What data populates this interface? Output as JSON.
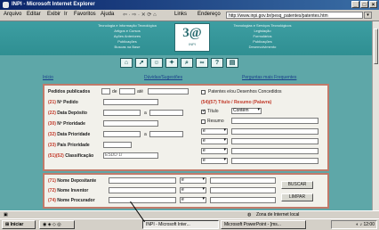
{
  "window": {
    "title": "INPI - Microsoft Internet Explorer"
  },
  "menu": [
    "Arquivo",
    "Editar",
    "Exibir",
    "Ir",
    "Favoritos",
    "Ajuda"
  ],
  "toolbar": {
    "links_label": "Links",
    "address_label": "Endereço",
    "address": "http://www.inpi.gov.br/pesq_patentes/patentes.htm"
  },
  "banner": {
    "logo_text": "3@",
    "logo_sub": "INPI",
    "left_lines": [
      "Tecnologia e Informação Tecnológica",
      "Artigos e Cursos",
      "Ações Anteriores",
      "Publicações",
      "Buscas na Base"
    ],
    "right_lines": [
      "Tecnologias e Serviços Tecnológicos",
      "Legislação",
      "Formulários",
      "Publicações",
      "Desenvolvimento"
    ]
  },
  "nav_icons": [
    "home-icon",
    "arrow-icon",
    "person-icon",
    "help-icon",
    "search-icon",
    "graph-icon",
    "question-icon",
    "book-icon"
  ],
  "links": {
    "home": "Início",
    "consult": "Dúvidas/Sugestões",
    "faq": "Perguntas mais Frequentes"
  },
  "form": {
    "published_label": "Pedidos publicados",
    "published_from": "de",
    "published_to": "até",
    "rows": [
      {
        "code": "(21)",
        "label": "Nº Pedido"
      },
      {
        "code": "(22)",
        "label": "Data Depósito"
      },
      {
        "code": "(30)",
        "label": "Nº Prioridade"
      },
      {
        "code": "(32)",
        "label": "Data Prioridade"
      },
      {
        "code": "(33)",
        "label": "País Prioridade"
      },
      {
        "code": "(51)(52)",
        "label": "Classificação",
        "value": "ESDD 1/"
      }
    ],
    "right_check_label": "Patentes e/ou Desenhos Concedidos",
    "title_group_label": "(54)(57) Título / Resumo (Palavra)",
    "title_check": "Título",
    "summary_check": "Resumo",
    "contains_select": "Contém",
    "logic_values": [
      "e",
      "e",
      "e",
      "e"
    ]
  },
  "form2": {
    "rows": [
      {
        "code": "(71)",
        "label": "Nome Depositante",
        "op": "e"
      },
      {
        "code": "(72)",
        "label": "Nome Inventor",
        "op": "e"
      },
      {
        "code": "(74)",
        "label": "Nome Procurador",
        "op": "e"
      }
    ],
    "search_button": "BUSCAR",
    "clear_button": "LIMPAR"
  },
  "status": {
    "zone": "Zona de Internet local"
  },
  "taskbar": {
    "start": "Iniciar",
    "items": [
      "INPI - Microsoft Inter...",
      "Microsoft PowerPoint - [ms..."
    ],
    "clock": "12:00"
  }
}
